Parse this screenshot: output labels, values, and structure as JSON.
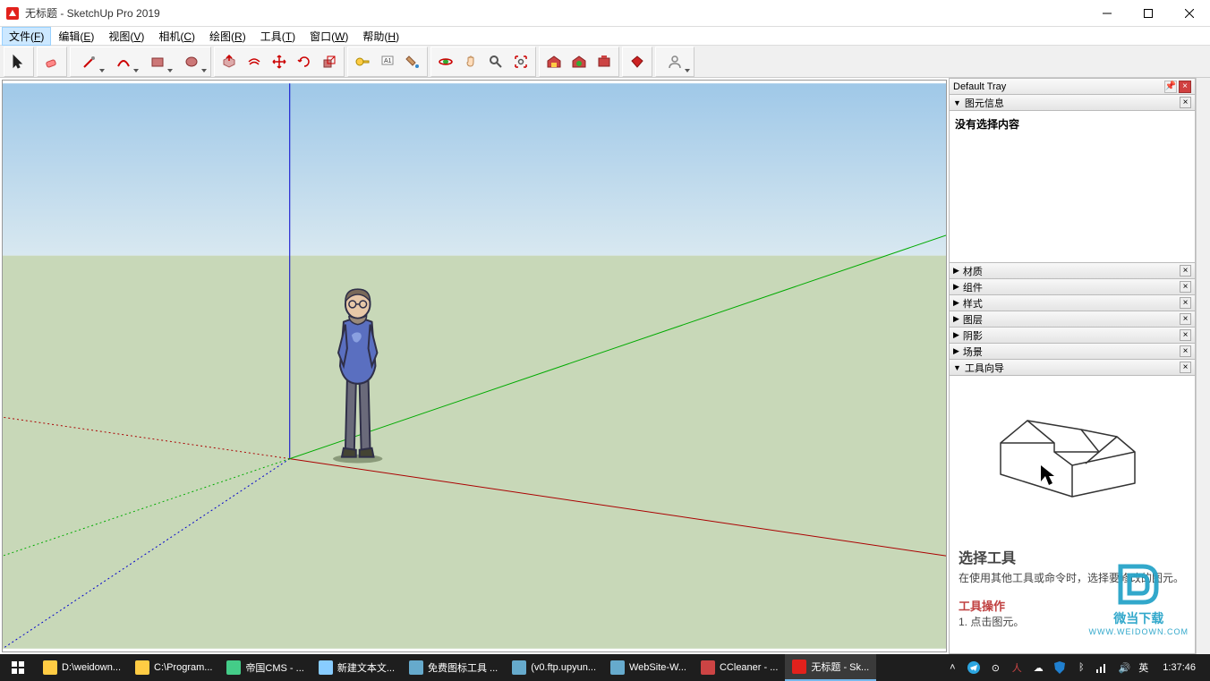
{
  "window": {
    "title": "无标题 - SketchUp Pro 2019"
  },
  "menu": [
    {
      "label": "文件(F)",
      "key": "F",
      "active": true
    },
    {
      "label": "编辑(E)",
      "key": "E"
    },
    {
      "label": "视图(V)",
      "key": "V"
    },
    {
      "label": "相机(C)",
      "key": "C"
    },
    {
      "label": "绘图(R)",
      "key": "R"
    },
    {
      "label": "工具(T)",
      "key": "T"
    },
    {
      "label": "窗口(W)",
      "key": "W"
    },
    {
      "label": "帮助(H)",
      "key": "H"
    }
  ],
  "tray": {
    "title": "Default Tray",
    "panels": {
      "entity": {
        "title": "图元信息",
        "expanded": true,
        "content": "没有选择内容"
      },
      "material": {
        "title": "材质",
        "expanded": false
      },
      "component": {
        "title": "组件",
        "expanded": false
      },
      "style": {
        "title": "样式",
        "expanded": false
      },
      "layer": {
        "title": "图层",
        "expanded": false
      },
      "shadow": {
        "title": "阴影",
        "expanded": false
      },
      "scene": {
        "title": "场景",
        "expanded": false
      },
      "instructor": {
        "title": "工具向导",
        "expanded": true,
        "tool_title": "选择工具",
        "tool_desc": "在使用其他工具或命令时，选择要修改的图元。",
        "op_title": "工具操作",
        "op_step": "1. 点击图元。"
      }
    }
  },
  "watermark": {
    "text": "微当下载",
    "url": "WWW.WEIDOWN.COM"
  },
  "taskbar": {
    "items": [
      {
        "label": "D:\\weidown...",
        "icon": "folder"
      },
      {
        "label": "C:\\Program...",
        "icon": "folder"
      },
      {
        "label": "帝国CMS - ...",
        "icon": "chrome"
      },
      {
        "label": "新建文本文...",
        "icon": "notepad"
      },
      {
        "label": "免费图标工具 ...",
        "icon": "app"
      },
      {
        "label": "(v0.ftp.upyun...",
        "icon": "app"
      },
      {
        "label": "WebSite-W...",
        "icon": "app"
      },
      {
        "label": "CCleaner - ...",
        "icon": "ccleaner"
      },
      {
        "label": "无标题 - Sk...",
        "icon": "sketchup",
        "active": true
      }
    ],
    "ime": "英",
    "clock": "1:37:46"
  }
}
